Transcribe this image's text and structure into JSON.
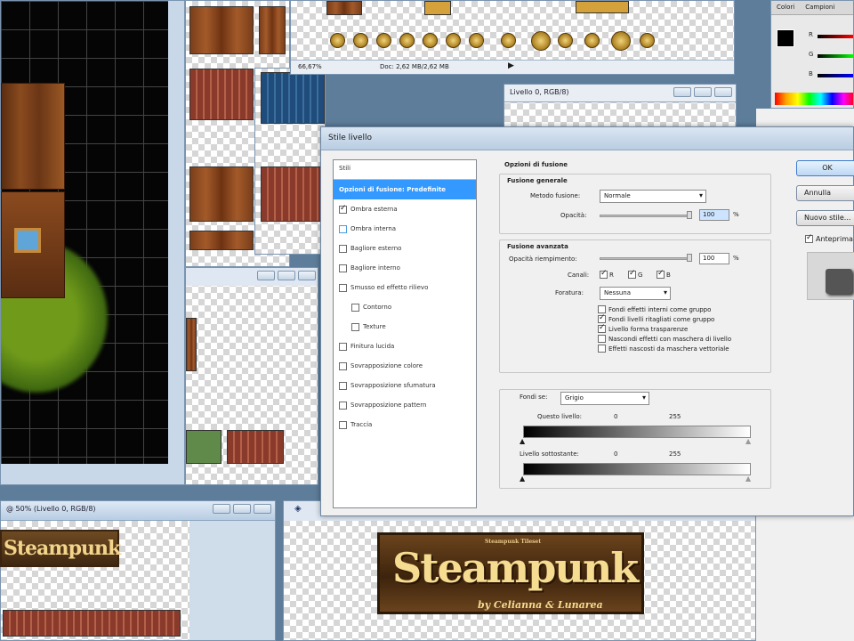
{
  "doc_window": {
    "zoom": "66,67%",
    "doc_info": "Doc: 2,62 MB/2,62 MB",
    "title_layer": "Livello 0, RGB/8)"
  },
  "bottom_doc": {
    "title": "@ 50% (Livello 0, RGB/8)"
  },
  "color_panel": {
    "tab_colori": "Colori",
    "tab_campioni": "Campioni",
    "channels": [
      "R",
      "G",
      "B"
    ]
  },
  "dialog": {
    "title": "Stile livello",
    "styles_header": "Stili",
    "styles": [
      {
        "label": "Opzioni di fusione: Predefinite",
        "selected": true,
        "checkbox": false
      },
      {
        "label": "Ombra esterna",
        "checked": true,
        "checkbox": true
      },
      {
        "label": "Ombra interna",
        "checked": false,
        "checkbox": true
      },
      {
        "label": "Bagliore esterno",
        "checked": false,
        "checkbox": true
      },
      {
        "label": "Bagliore interno",
        "checked": false,
        "checkbox": true
      },
      {
        "label": "Smusso ed effetto rilievo",
        "checked": false,
        "checkbox": true
      },
      {
        "label": "Contorno",
        "checked": false,
        "checkbox": true,
        "sub": true
      },
      {
        "label": "Texture",
        "checked": false,
        "checkbox": true,
        "sub": true
      },
      {
        "label": "Finitura lucida",
        "checked": false,
        "checkbox": true
      },
      {
        "label": "Sovrapposizione colore",
        "checked": false,
        "checkbox": true
      },
      {
        "label": "Sovrapposizione sfumatura",
        "checked": false,
        "checkbox": true
      },
      {
        "label": "Sovrapposizione pattern",
        "checked": false,
        "checkbox": true
      },
      {
        "label": "Traccia",
        "checked": false,
        "checkbox": true
      }
    ],
    "blend_options_title": "Opzioni di fusione",
    "general_title": "Fusione generale",
    "blend_mode_label": "Metodo fusione:",
    "blend_mode_value": "Normale",
    "opacity_label": "Opacità:",
    "opacity_value": "100",
    "opacity_unit": "%",
    "advanced_title": "Fusione avanzata",
    "fill_opacity_label": "Opacità riempimento:",
    "fill_opacity_value": "100",
    "fill_unit": "%",
    "channels_label": "Canali:",
    "channels": [
      "R",
      "G",
      "B"
    ],
    "knockout_label": "Foratura:",
    "knockout_value": "Nessuna",
    "advanced_checks": [
      {
        "label": "Fondi effetti interni come gruppo",
        "checked": false
      },
      {
        "label": "Fondi livelli ritagliati come gruppo",
        "checked": true
      },
      {
        "label": "Livello forma trasparenze",
        "checked": true
      },
      {
        "label": "Nascondi effetti con maschera di livello",
        "checked": false
      },
      {
        "label": "Effetti nascosti da maschera vettoriale",
        "checked": false
      }
    ],
    "blend_if_label": "Fondi se:",
    "blend_if_value": "Grigio",
    "this_layer_label": "Questo livello:",
    "this_layer_min": "0",
    "this_layer_max": "255",
    "underlying_label": "Livello sottostante:",
    "underlying_min": "0",
    "underlying_max": "255",
    "ok_label": "OK",
    "cancel_label": "Annulla",
    "new_style_label": "Nuovo stile...",
    "preview_label": "Anteprima"
  },
  "artwork": {
    "steampunk_small": "Steampunk",
    "steampunk_big": "Steampunk",
    "subtitle": "by Celianna & Lunarea",
    "tagline": "Steampunk Tileset"
  }
}
